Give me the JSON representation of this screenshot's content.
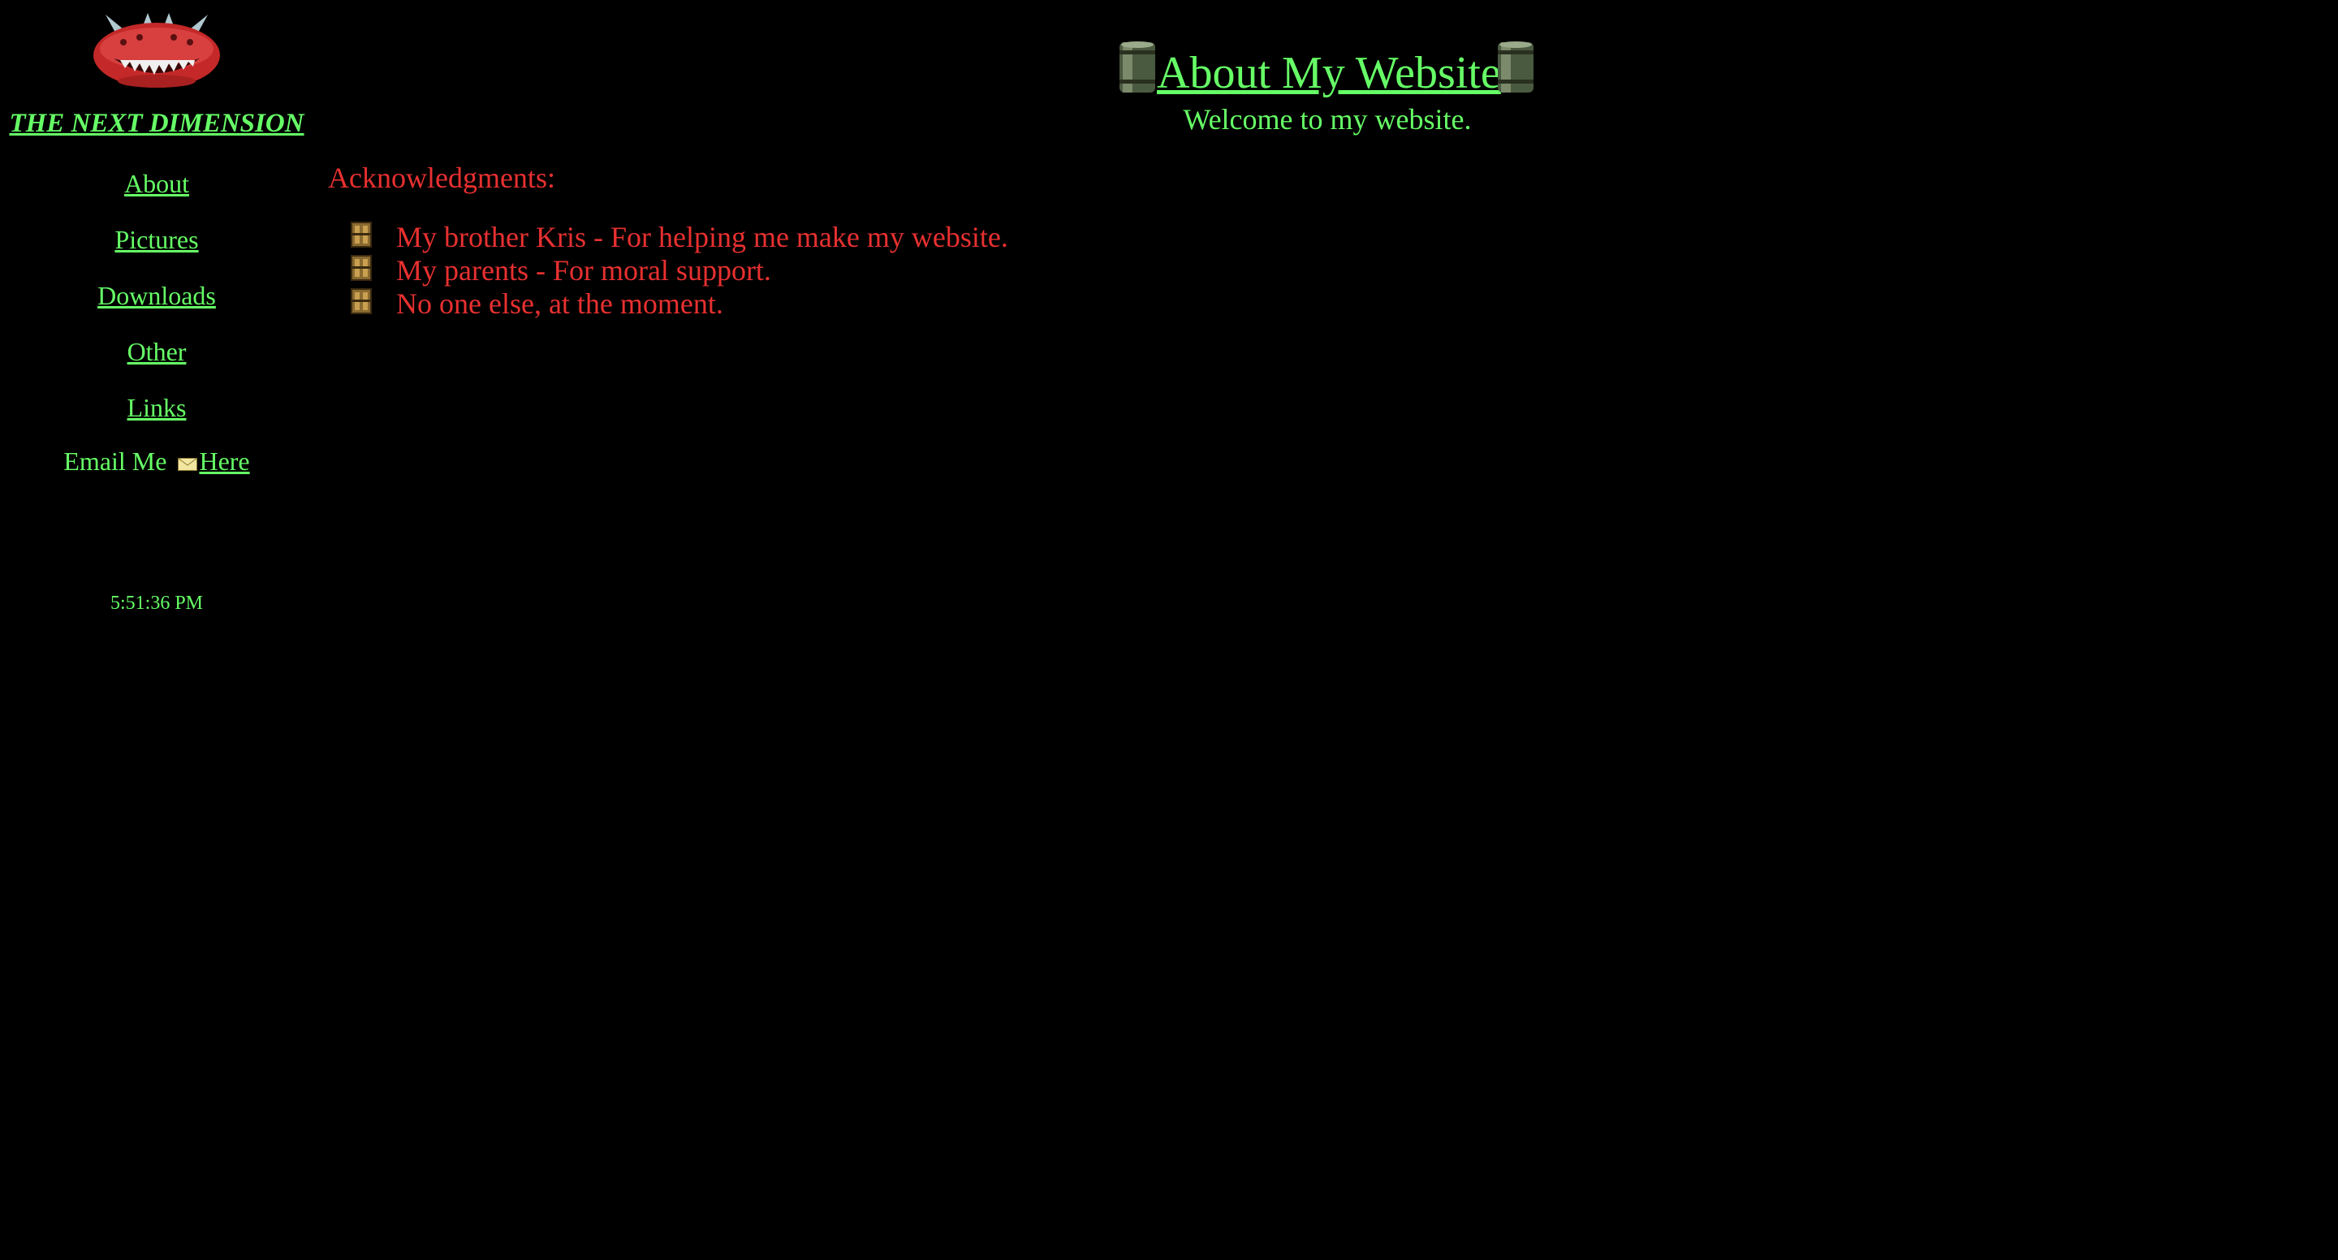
{
  "colors": {
    "background": "#000000",
    "link_green": "#66ff66",
    "text_red": "#e83030"
  },
  "sidebar": {
    "logo_icon": "cacodemon-logo-icon",
    "site_title": "THE NEXT DIMENSION",
    "nav": [
      {
        "label": "About"
      },
      {
        "label": "Pictures"
      },
      {
        "label": "Downloads"
      },
      {
        "label": "Other"
      },
      {
        "label": "Links"
      }
    ],
    "email": {
      "prefix": "Email Me",
      "icon": "envelope-icon",
      "link_label": "Here"
    },
    "clock": "5:51:36 PM"
  },
  "header": {
    "title": "About My Website",
    "subtitle": "Welcome to my website.",
    "decoration_icon": "barrel-icon"
  },
  "main": {
    "heading": "Acknowledgments:",
    "bullet_icon": "door-bullet-icon",
    "items": [
      {
        "text": "My brother Kris - For helping me make my website."
      },
      {
        "text": "My parents - For moral support."
      },
      {
        "text": "No one else, at the moment."
      }
    ]
  }
}
